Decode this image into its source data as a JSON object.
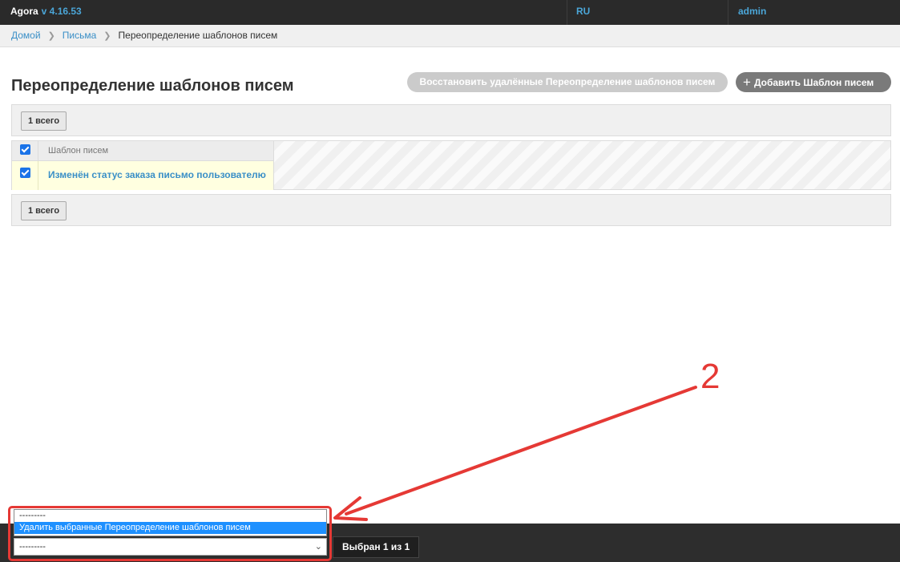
{
  "header": {
    "app_name": "Agora",
    "version": "v 4.16.53",
    "language": "RU",
    "user": "admin"
  },
  "breadcrumb": {
    "items": [
      "Домой",
      "Письма"
    ],
    "current": "Переопределение шаблонов писем"
  },
  "page": {
    "title": "Переопределение шаблонов писем",
    "restore_button": "Восстановить удалённые Переопределение шаблонов писем",
    "add_button": "Добавить Шаблон писем"
  },
  "pagination": {
    "count_label": "1 всего"
  },
  "table": {
    "column_header": "Шаблон писем",
    "rows": [
      {
        "title": "Изменён статус заказа письмо пользователю",
        "checked": true
      }
    ]
  },
  "actions": {
    "selected_value": "---------",
    "options": [
      "---------",
      "Удалить выбранные Переопределение шаблонов писем"
    ],
    "highlighted_option": "Удалить выбранные Переопределение шаблонов писем",
    "selected_count": "Выбран 1 из 1"
  },
  "annotation": {
    "step_number": "2",
    "color": "#e53935"
  },
  "colors": {
    "topbar_bg": "#2a2a2a",
    "link": "#3a8fc7",
    "accent_blue": "#4ba6d8",
    "row_highlight": "#ffffe0",
    "option_highlight": "#1e90ff"
  }
}
